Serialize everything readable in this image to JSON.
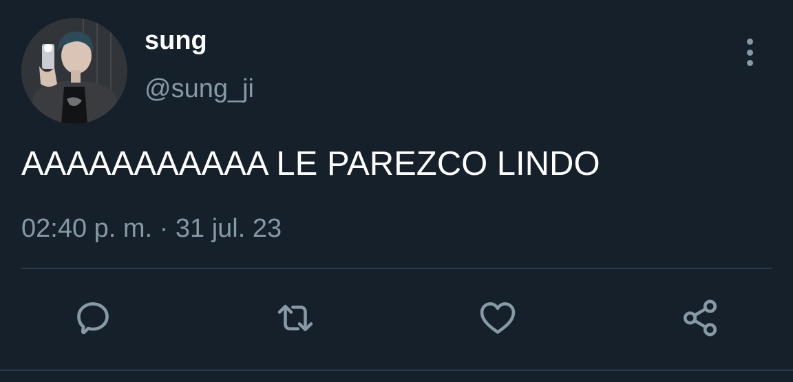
{
  "author": {
    "display_name": "sung",
    "handle": "@sung_ji"
  },
  "tweet": {
    "text": "AAAAAAAAAAA LE PAREZCO LINDO",
    "timestamp": "02:40 p. m. · 31 jul. 23"
  },
  "actions": {
    "reply_icon": "reply-icon",
    "retweet_icon": "retweet-icon",
    "like_icon": "heart-icon",
    "share_icon": "share-icon",
    "more_icon": "more-vertical-icon"
  },
  "colors": {
    "background": "#15202b",
    "primary_text": "#ffffff",
    "secondary_text": "#8899a6",
    "divider": "#2f3d4a"
  }
}
